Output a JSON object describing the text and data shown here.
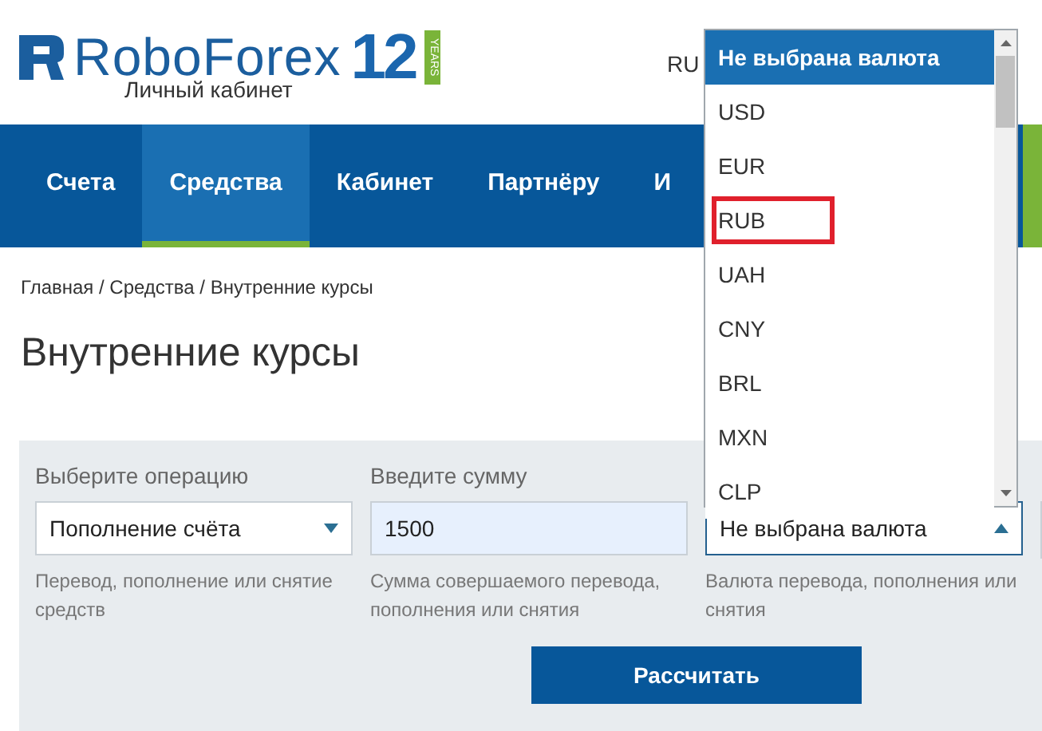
{
  "header": {
    "brand": "RoboForex",
    "anniversary": "12",
    "anniversary_label": "YEARS",
    "subtitle": "Личный кабинет",
    "language": "RU"
  },
  "nav": [
    {
      "label": "Счета",
      "selected": false
    },
    {
      "label": "Средства",
      "selected": true
    },
    {
      "label": "Кабинет",
      "selected": false
    },
    {
      "label": "Партнёру",
      "selected": false
    },
    {
      "label": "И",
      "selected": false
    }
  ],
  "breadcrumb": "Главная / Средства / Внутренние курсы",
  "title": "Внутренние курсы",
  "form": {
    "fields": [
      {
        "kind": "select",
        "label": "Выберите операцию",
        "value": "Пополнение счёта",
        "hint": "Перевод, пополнение или снятие средств",
        "expanded": false
      },
      {
        "kind": "input",
        "label": "Введите сумму",
        "value": "1500",
        "hint": "Сумма совершаемого перевода, пополнения или снятия"
      },
      {
        "kind": "select",
        "value": "Не выбрана валюта",
        "hint": "Валюта перевода, пополнения или снятия",
        "expanded": true
      }
    ],
    "submit": "Рассчитать"
  },
  "currency_dropdown": [
    {
      "label": "Не выбрана валюта",
      "selected": true,
      "marked": false
    },
    {
      "label": "USD",
      "selected": false,
      "marked": false
    },
    {
      "label": "EUR",
      "selected": false,
      "marked": false
    },
    {
      "label": "RUB",
      "selected": false,
      "marked": true
    },
    {
      "label": "UAH",
      "selected": false,
      "marked": false
    },
    {
      "label": "CNY",
      "selected": false,
      "marked": false
    },
    {
      "label": "BRL",
      "selected": false,
      "marked": false
    },
    {
      "label": "MXN",
      "selected": false,
      "marked": false
    },
    {
      "label": "CLP",
      "selected": false,
      "marked": false
    }
  ]
}
